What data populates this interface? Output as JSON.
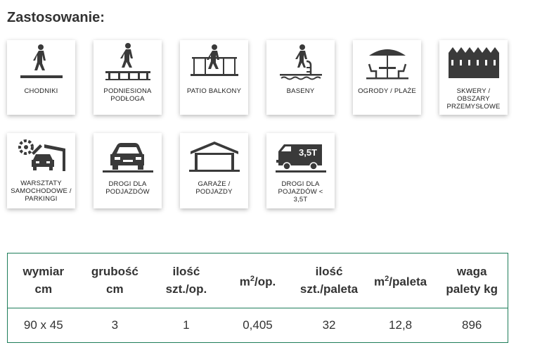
{
  "heading": "Zastosowanie:",
  "applications": [
    {
      "label": "CHODNIKI",
      "icon": "pedestrian-walkway-icon"
    },
    {
      "label": "PODNIESIONA PODŁOGA",
      "icon": "raised-floor-icon"
    },
    {
      "label": "PATIO BALKONY",
      "icon": "balcony-railing-icon"
    },
    {
      "label": "BASENY",
      "icon": "pool-ladder-icon"
    },
    {
      "label": "OGRODY / PLAŻE",
      "icon": "umbrella-table-icon"
    },
    {
      "label": "SKWERY / OBSZARY PRZEMYSŁOWE",
      "icon": "industrial-buildings-icon"
    },
    {
      "label": "WARSZTATY SAMOCHODOWE / PARKINGI",
      "icon": "car-workshop-icon"
    },
    {
      "label": "DROGI DLA PODJAZDÓW",
      "icon": "car-front-icon"
    },
    {
      "label": "GARAŻE / PODJAZDY",
      "icon": "garage-icon"
    },
    {
      "label": "DROGI DLA POJAZDÓW < 3,5T",
      "icon": "van-3-5t-icon",
      "badge": "3,5T"
    }
  ],
  "table": {
    "headers": [
      {
        "line1": "wymiar",
        "line2": "cm"
      },
      {
        "line1": "grubość",
        "line2": "cm"
      },
      {
        "line1": "ilość",
        "line2": "szt./op."
      },
      {
        "base": "m",
        "sup": "2",
        "rest": "/op."
      },
      {
        "line1": "ilość",
        "line2": "szt./paleta"
      },
      {
        "base": "m",
        "sup": "2",
        "rest": "/paleta"
      },
      {
        "line1": "waga",
        "line2": "palety kg"
      }
    ],
    "row": [
      "90 x 45",
      "3",
      "1",
      "0,405",
      "32",
      "12,8",
      "896"
    ]
  },
  "colors": {
    "border": "#1e7d5a",
    "icon": "#3a3a3a"
  }
}
